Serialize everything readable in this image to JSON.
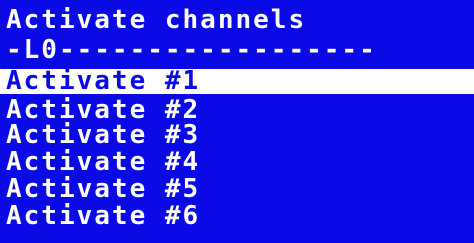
{
  "screen": {
    "title": "Activate channels",
    "subtitle": "-L0------------------",
    "colors": {
      "background": "#0a0ae6",
      "text": "#ffffff",
      "selection_bg": "#ffffff",
      "selection_text": "#0a0ae6"
    }
  },
  "menu": {
    "items": [
      {
        "label": "Activate #1",
        "selected": true
      },
      {
        "label": "Activate #2",
        "selected": false
      },
      {
        "label": "Activate #3",
        "selected": false
      },
      {
        "label": "Activate #4",
        "selected": false
      },
      {
        "label": "Activate #5",
        "selected": false
      },
      {
        "label": "Activate #6",
        "selected": false
      }
    ]
  }
}
